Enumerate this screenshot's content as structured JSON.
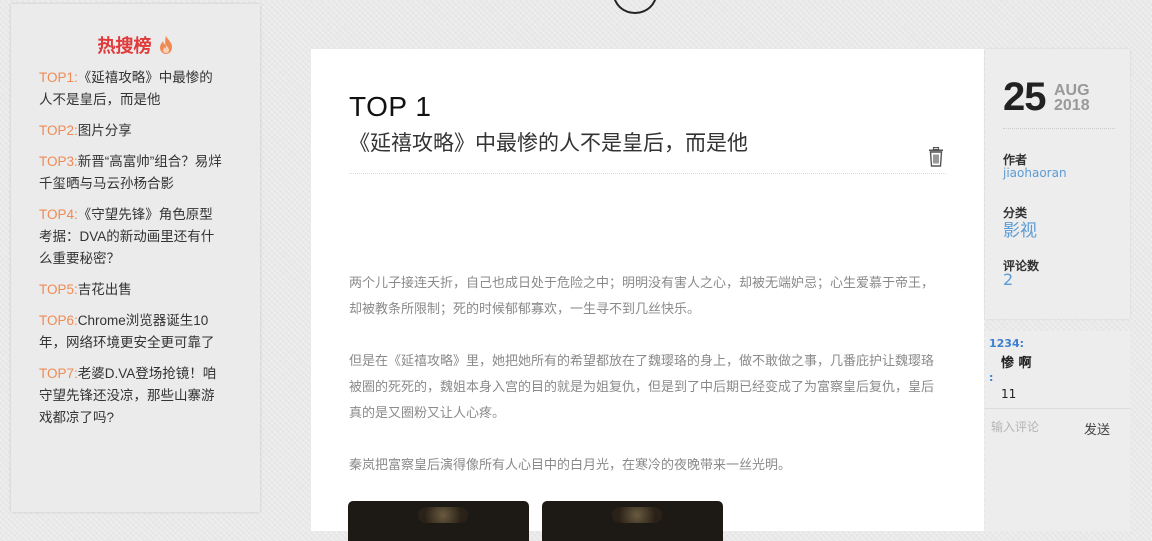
{
  "hot": {
    "title": "热搜榜",
    "icon": "fire-icon",
    "accent_color": "#e03a3a",
    "rank_color": "#f08a55",
    "items": [
      {
        "rank": "TOP1:",
        "text": "《延禧攻略》中最惨的人不是皇后，而是他"
      },
      {
        "rank": "TOP2:",
        "text": "图片分享"
      },
      {
        "rank": "TOP3:",
        "text": "新晋“高富帅”组合？易烊千玺晒与马云孙杨合影"
      },
      {
        "rank": "TOP4:",
        "text": "《守望先锋》角色原型考据：DVA的新动画里还有什么重要秘密？"
      },
      {
        "rank": "TOP5:",
        "text": "吉花出售"
      },
      {
        "rank": "TOP6:",
        "text": "Chrome浏览器诞生10年，网络环境更安全更可靠了"
      },
      {
        "rank": "TOP7:",
        "text": "老婆D.VA登场抢镜！咱守望先锋还没凉，那些山寨游戏都凉了吗?"
      }
    ]
  },
  "article": {
    "top_label": "TOP 1",
    "title": "《延禧攻略》中最惨的人不是皇后，而是他",
    "paragraphs": [
      "两个儿子接连夭折，自己也成日处于危险之中；明明没有害人之心，却被无端妒忌；心生爱慕于帝王，却被教条所限制；死的时候郁郁寡欢，一生寻不到几丝快乐。",
      "但是在《延禧攻略》里，她把她所有的希望都放在了魏璎珞的身上，做不敢做之事，几番庇护让魏璎珞被圈的死死的，魏姐本身入宫的目的就是为姐复仇，但是到了中后期已经变成了为富察皇后复仇，皇后真的是又圈粉又让人心疼。",
      "秦岚把富察皇后演得像所有人心目中的白月光，在寒冷的夜晚带来一丝光明。"
    ]
  },
  "meta": {
    "day": "25",
    "month": "AUG",
    "year": "2018",
    "author_label": "作者",
    "author": "jiaohaoran",
    "category_label": "分类",
    "category": "影视",
    "comments_label": "评论数",
    "comments_count": "2",
    "link_color": "#5b9bd5"
  },
  "comments": {
    "entries": [
      {
        "user": "1234:",
        "text": "惨 啊"
      },
      {
        "user": ":",
        "text": "11"
      }
    ],
    "input_placeholder": "输入评论",
    "send_label": "发送"
  }
}
